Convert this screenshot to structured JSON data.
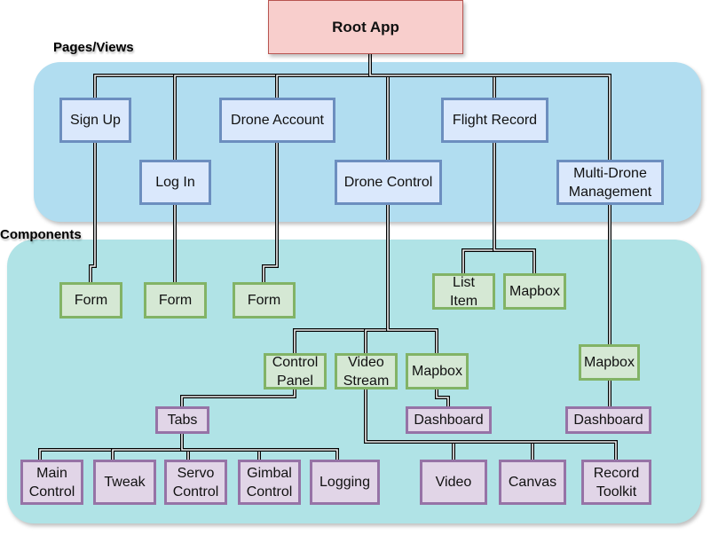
{
  "colors": {
    "root_fill": "#f8cecc",
    "page_fill": "#dae8fc",
    "component_fill": "#d5e8d4",
    "subcomponent_fill": "#e1d5e7",
    "pages_region": "#b1ddf0",
    "components_region": "#b0e3e6"
  },
  "regions": {
    "pages": "Pages/Views",
    "components": "Components"
  },
  "nodes": {
    "root": "Root App",
    "sign_up": "Sign Up",
    "log_in": "Log In",
    "drone_account": "Drone Account",
    "drone_control": "Drone Control",
    "flight_record": "Flight Record",
    "multi_drone": "Multi-Drone Management",
    "form1": "Form",
    "form2": "Form",
    "form3": "Form",
    "list_item": "List Item",
    "mapbox1": "Mapbox",
    "control_panel": "Control Panel",
    "video_stream": "Video Stream",
    "mapbox2": "Mapbox",
    "mapbox3": "Mapbox",
    "tabs": "Tabs",
    "dashboard1": "Dashboard",
    "dashboard2": "Dashboard",
    "main_control": "Main Control",
    "tweak": "Tweak",
    "servo_control": "Servo Control",
    "gimbal_control": "Gimbal Control",
    "logging": "Logging",
    "video": "Video",
    "canvas": "Canvas",
    "record_toolkit": "Record Toolkit"
  },
  "edges": [
    [
      "root",
      "sign_up"
    ],
    [
      "root",
      "log_in"
    ],
    [
      "root",
      "drone_account"
    ],
    [
      "root",
      "drone_control"
    ],
    [
      "root",
      "flight_record"
    ],
    [
      "root",
      "multi_drone"
    ],
    [
      "sign_up",
      "form1"
    ],
    [
      "log_in",
      "form2"
    ],
    [
      "drone_account",
      "form3"
    ],
    [
      "flight_record",
      "list_item"
    ],
    [
      "flight_record",
      "mapbox1"
    ],
    [
      "drone_control",
      "control_panel"
    ],
    [
      "drone_control",
      "video_stream"
    ],
    [
      "drone_control",
      "mapbox2"
    ],
    [
      "multi_drone",
      "mapbox3"
    ],
    [
      "mapbox2",
      "dashboard1"
    ],
    [
      "mapbox3",
      "dashboard2"
    ],
    [
      "control_panel",
      "tabs"
    ],
    [
      "tabs",
      "main_control"
    ],
    [
      "tabs",
      "tweak"
    ],
    [
      "tabs",
      "servo_control"
    ],
    [
      "tabs",
      "gimbal_control"
    ],
    [
      "tabs",
      "logging"
    ],
    [
      "video_stream",
      "video"
    ],
    [
      "video_stream",
      "canvas"
    ],
    [
      "video_stream",
      "record_toolkit"
    ]
  ]
}
